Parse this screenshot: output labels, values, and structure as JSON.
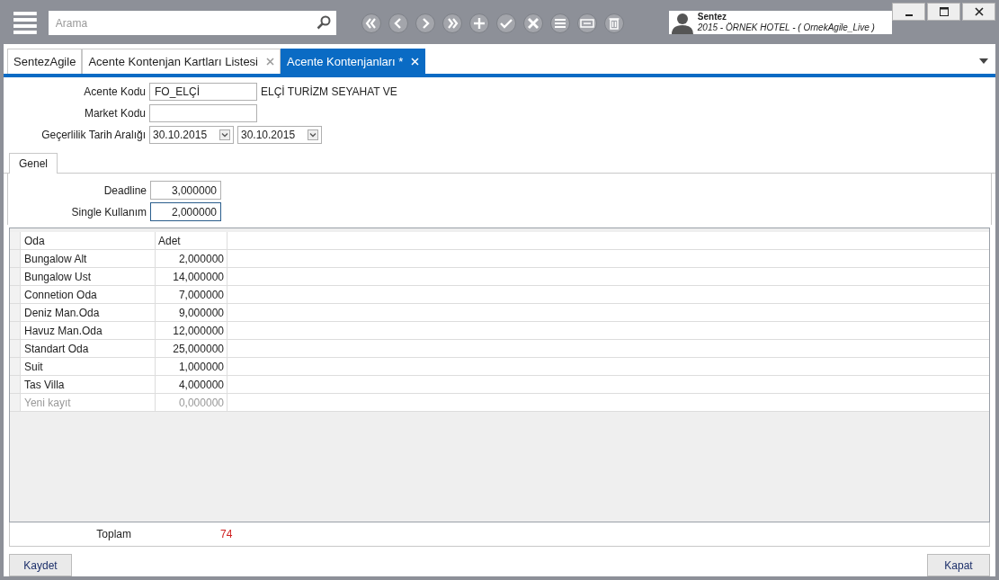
{
  "search": {
    "placeholder": "Arama"
  },
  "user": {
    "name": "Sentez",
    "context": "2015 - ÖRNEK HOTEL - ( OrnekAgile_Live )"
  },
  "tabs": [
    {
      "label": "SentezAgile",
      "selected": false,
      "closable": false
    },
    {
      "label": "Acente Kontenjan Kartları Listesi",
      "selected": false,
      "closable": true
    },
    {
      "label": "Acente Kontenjanları *",
      "selected": true,
      "closable": true
    }
  ],
  "header_form": {
    "agency_code": {
      "label": "Acente Kodu",
      "value": "FO_ELÇİ",
      "description": "ELÇİ TURİZM SEYAHAT VE"
    },
    "market_code": {
      "label": "Market Kodu"
    },
    "validity_range": {
      "label": "Geçerlilik Tarih Aralığı",
      "start": "30.10.2015",
      "end": "30.10.2015"
    }
  },
  "inner_tabs": [
    {
      "label": "Genel",
      "selected": true
    }
  ],
  "general_fields": [
    {
      "label": "Deadline",
      "value": "3,000000",
      "focused": false
    },
    {
      "label": "Single Kullanım",
      "value": "2,000000",
      "focused": true
    }
  ],
  "table": {
    "columns": [
      "Oda",
      "Adet"
    ],
    "rows": [
      {
        "kind": "item",
        "cells": [
          "Bungalow Alt",
          "2,000000"
        ]
      },
      {
        "kind": "item",
        "cells": [
          "Bungalow Ust",
          "14,000000"
        ]
      },
      {
        "kind": "item",
        "cells": [
          "Connetion Oda",
          "7,000000"
        ]
      },
      {
        "kind": "item",
        "cells": [
          "Deniz Man.Oda",
          "9,000000"
        ]
      },
      {
        "kind": "item",
        "cells": [
          "Havuz Man.Oda",
          "12,000000"
        ]
      },
      {
        "kind": "item",
        "cells": [
          "Standart Oda",
          "25,000000"
        ]
      },
      {
        "kind": "item",
        "cells": [
          "Suit",
          "1,000000"
        ]
      },
      {
        "kind": "item",
        "cells": [
          "Tas Villa",
          "4,000000"
        ]
      },
      {
        "kind": "new_row",
        "cells": [
          "Yeni kayıt",
          "0,000000"
        ]
      }
    ]
  },
  "total": {
    "label": "Toplam",
    "value": "74"
  },
  "buttons": {
    "save": "Kaydet",
    "close": "Kapat"
  }
}
